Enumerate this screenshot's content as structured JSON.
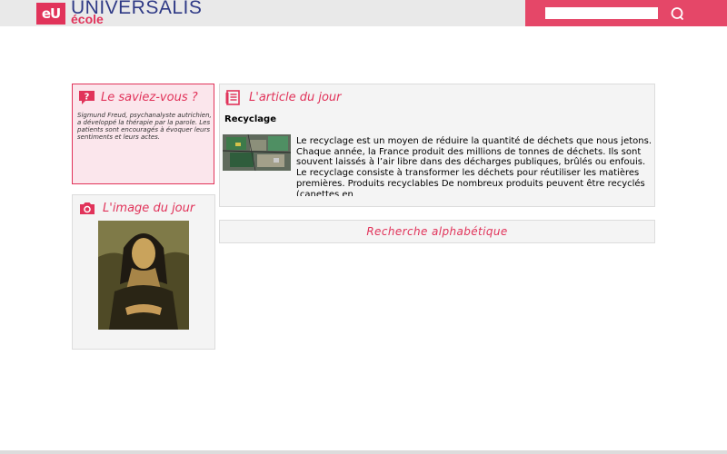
{
  "header": {
    "logo_mark": "eU",
    "brand_name": "UNIVERSALIS",
    "brand_sub": "école",
    "search": {
      "value": "",
      "placeholder": ""
    },
    "colors": {
      "brand_blue": "#2f3a86",
      "accent": "#e1335a",
      "search_bg": "#e54768"
    }
  },
  "saviez": {
    "title": "Le saviez-vous ?",
    "icon": "question-mark-icon",
    "text": "Sigmund Freud, psychanalyste autrichien, a développé la thérapie par la parole. Les patients sont encouragés à évoquer leurs sentiments et leurs actes."
  },
  "article": {
    "title": "L'article du jour",
    "icon": "document-icon",
    "headline": "Recyclage",
    "thumbnail": "recycling-electronics-photo",
    "body": " Le recyclage est un moyen de réduire la quantité de déchets que nous jetons. Chaque année, la France produit des millions de tonnes de déchets. Ils sont souvent laissés à l’air libre dans des décharges publiques, brûlés ou enfouis. Le recyclage consiste à transformer les déchets pour réutiliser les matières premières. Produits recyclables De nombreux produits peuvent être recyclés (canettes en"
  },
  "image_jour": {
    "title": "L'image du jour",
    "icon": "camera-icon",
    "image": "mona-lisa-painting"
  },
  "alpha": {
    "label": "Recherche alphabétique"
  }
}
